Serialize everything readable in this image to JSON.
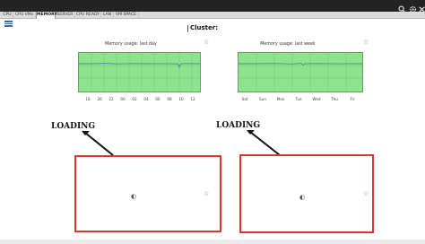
{
  "tabs": [
    {
      "label": "CPU"
    },
    {
      "label": "CPU VMs"
    },
    {
      "label": "MEMORY",
      "active": true
    },
    {
      "label": "SERVER"
    },
    {
      "label": "CPU READY"
    },
    {
      "label": "LAN"
    },
    {
      "label": "VM SPACE"
    }
  ],
  "header": {
    "cluster_label": "Cluster:"
  },
  "toolbar_icons": [
    "search-icon",
    "gear-icon",
    "close-icon"
  ],
  "charts": [
    {
      "title": "Memory usage: last day",
      "x_ticks": [
        "18",
        "20",
        "22",
        "00",
        "02",
        "04",
        "06",
        "08",
        "10",
        "12"
      ]
    },
    {
      "title": "Memory usage: last week",
      "x_ticks": [
        "Sat",
        "Sun",
        "Mon",
        "Tue",
        "Wed",
        "Thu",
        "Fri"
      ]
    }
  ],
  "annotations": [
    {
      "text": "LOADING"
    },
    {
      "text": "LOADING"
    }
  ],
  "colors": {
    "chart_fill": "#8fe38f",
    "chart_line": "#3a8fa8",
    "highlight_border": "#d93636"
  }
}
